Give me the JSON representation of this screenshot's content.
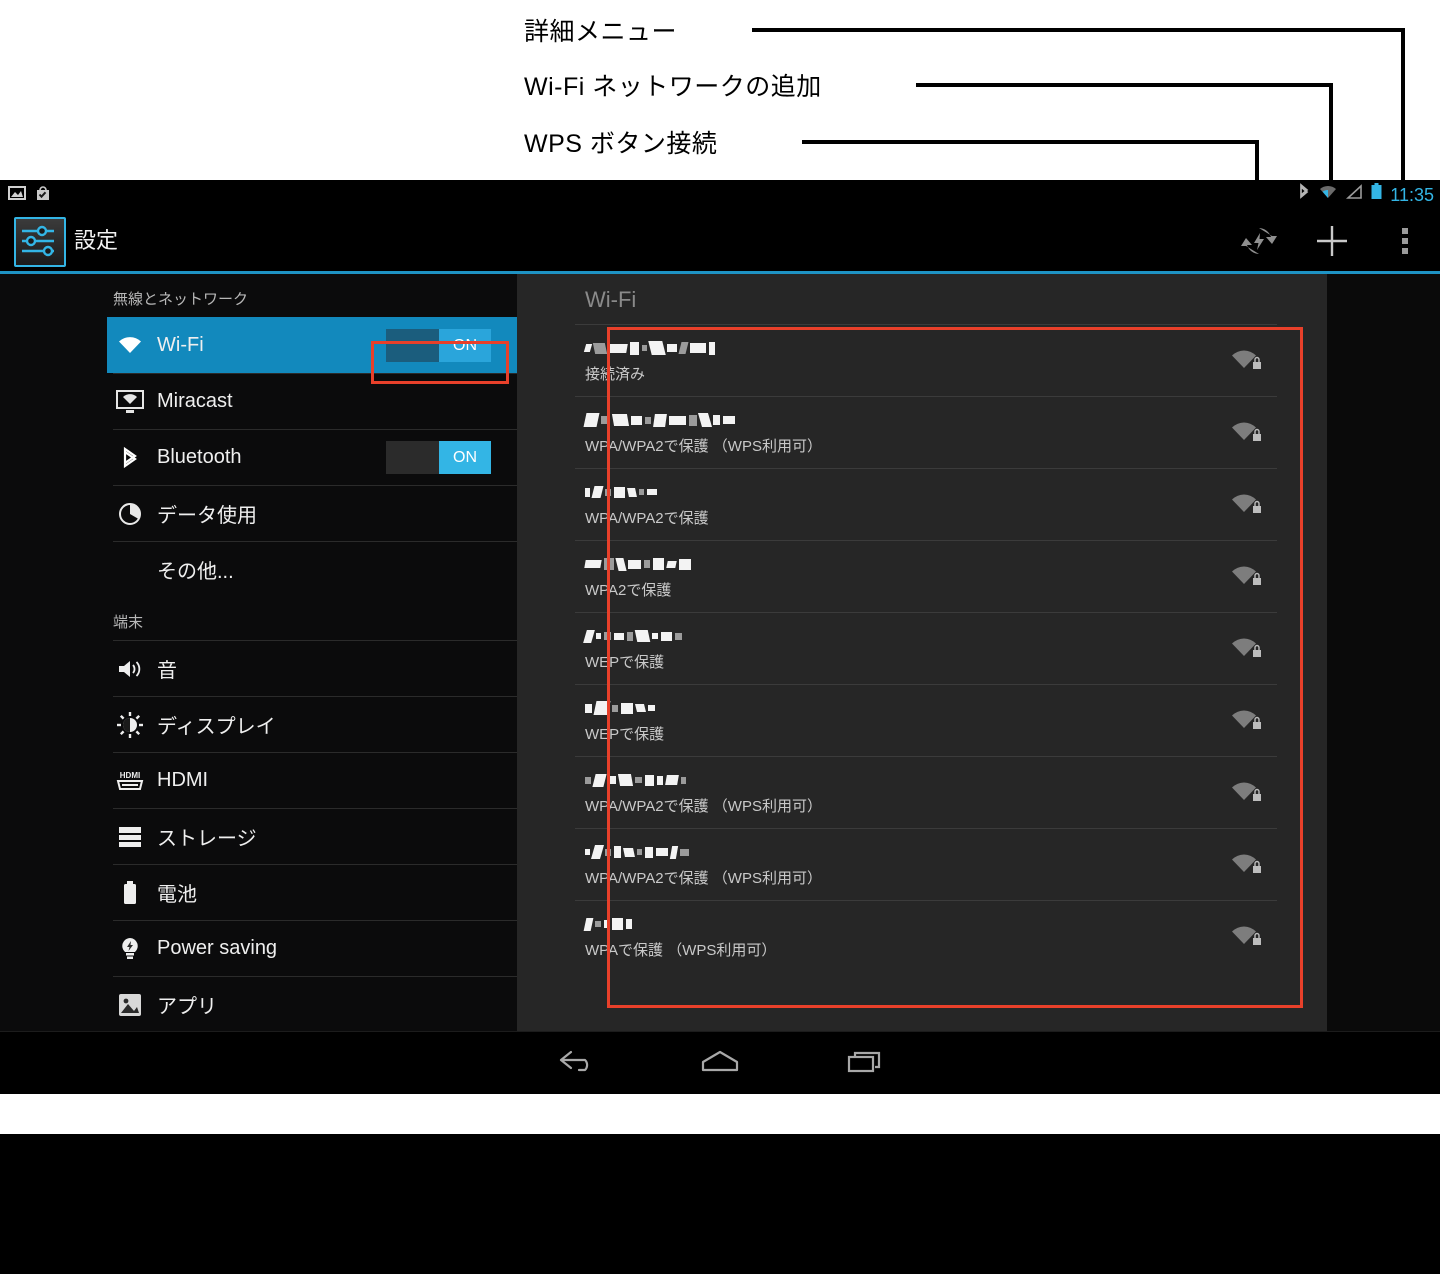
{
  "annotations": {
    "callouts": [
      {
        "label": "詳細メニュー",
        "target": "overflow-menu-button"
      },
      {
        "label": "Wi-Fi ネットワークの追加",
        "target": "add-network-button"
      },
      {
        "label": "WPS ボタン接続",
        "target": "wps-button"
      }
    ]
  },
  "statusbar": {
    "left_icons": [
      "screenshot-icon",
      "play-store-update-icon"
    ],
    "right_icons": [
      "bluetooth-icon",
      "wifi-signal-icon",
      "cellular-signal-icon",
      "battery-icon"
    ],
    "time": "11:35"
  },
  "actionbar": {
    "app_icon": "settings-sliders-icon",
    "title": "設定",
    "actions": [
      {
        "name": "wps-button",
        "icon": "wps-refresh-icon"
      },
      {
        "name": "add-network-button",
        "icon": "plus-icon"
      },
      {
        "name": "overflow-menu-button",
        "icon": "overflow-dots-icon"
      }
    ]
  },
  "sidebar": {
    "sections": [
      {
        "header": "無線とネットワーク",
        "items": [
          {
            "label": "Wi-Fi",
            "icon": "wifi-icon",
            "selected": true,
            "toggle": "ON"
          },
          {
            "label": "Miracast",
            "icon": "miracast-icon",
            "selected": false,
            "toggle": null
          },
          {
            "label": "Bluetooth",
            "icon": "bluetooth-icon",
            "selected": false,
            "toggle": "ON"
          },
          {
            "label": "データ使用",
            "icon": "data-usage-icon",
            "selected": false,
            "toggle": null
          },
          {
            "label": "その他...",
            "icon": null,
            "selected": false,
            "toggle": null
          }
        ]
      },
      {
        "header": "端末",
        "items": [
          {
            "label": "音",
            "icon": "sound-icon",
            "selected": false,
            "toggle": null
          },
          {
            "label": "ディスプレイ",
            "icon": "display-icon",
            "selected": false,
            "toggle": null
          },
          {
            "label": "HDMI",
            "icon": "hdmi-icon",
            "selected": false,
            "toggle": null
          },
          {
            "label": "ストレージ",
            "icon": "storage-icon",
            "selected": false,
            "toggle": null
          },
          {
            "label": "電池",
            "icon": "battery-icon",
            "selected": false,
            "toggle": null
          },
          {
            "label": "Power saving",
            "icon": "power-saving-icon",
            "selected": false,
            "toggle": null
          },
          {
            "label": "アプリ",
            "icon": "apps-icon",
            "selected": false,
            "toggle": null
          }
        ]
      }
    ]
  },
  "wifi_panel": {
    "title": "Wi-Fi",
    "networks": [
      {
        "ssid": "[redacted]",
        "status": "接続済み",
        "signal": "wifi-signal-lock-icon"
      },
      {
        "ssid": "[redacted]",
        "status": "WPA/WPA2で保護 （WPS利用可）",
        "signal": "wifi-signal-lock-icon"
      },
      {
        "ssid": "[redacted]",
        "status": "WPA/WPA2で保護",
        "signal": "wifi-signal-lock-icon"
      },
      {
        "ssid": "[redacted]",
        "status": "WPA2で保護",
        "signal": "wifi-signal-lock-icon"
      },
      {
        "ssid": "[redacted]",
        "status": "WEPで保護",
        "signal": "wifi-signal-lock-icon"
      },
      {
        "ssid": "[redacted]",
        "status": "WEPで保護",
        "signal": "wifi-signal-lock-icon"
      },
      {
        "ssid": "[redacted]",
        "status": "WPA/WPA2で保護 （WPS利用可）",
        "signal": "wifi-signal-lock-icon"
      },
      {
        "ssid": "[redacted]",
        "status": "WPA/WPA2で保護 （WPS利用可）",
        "signal": "wifi-signal-lock-icon"
      },
      {
        "ssid": "[redacted]",
        "status": "WPAで保護 （WPS利用可）",
        "signal": "wifi-signal-lock-icon"
      }
    ]
  },
  "navbar": {
    "buttons": [
      {
        "name": "back-button",
        "icon": "back-arrow-icon"
      },
      {
        "name": "home-button",
        "icon": "home-icon"
      },
      {
        "name": "recents-button",
        "icon": "recents-icon"
      }
    ]
  },
  "colors": {
    "accent": "#33b5e5",
    "selected_row": "#1289bd",
    "highlight_box": "#e8402a",
    "panel_bg": "#262626",
    "sidebar_bg": "#0b0b0c"
  }
}
